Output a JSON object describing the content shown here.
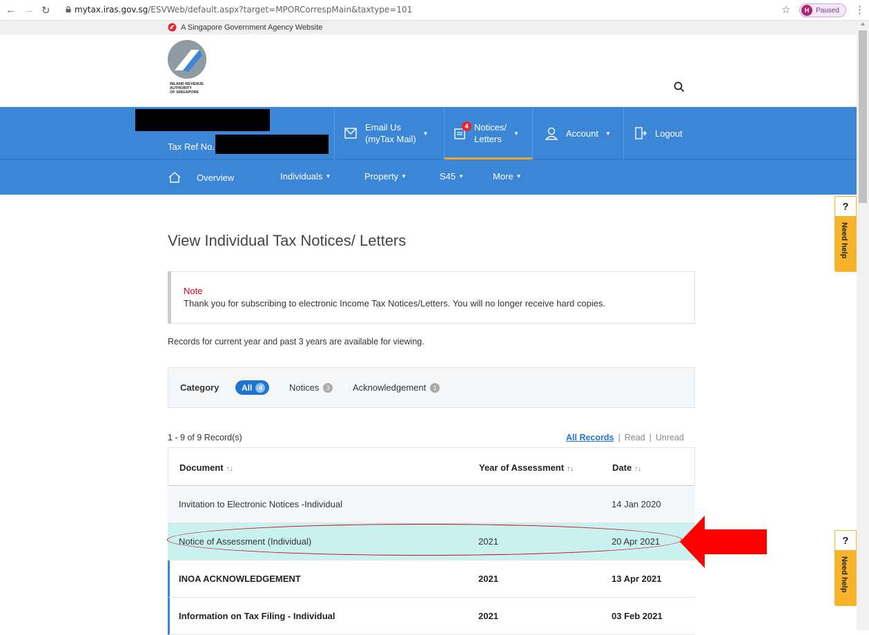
{
  "browser": {
    "url_host": "mytax.iras.gov.sg",
    "url_path": "/ESVWeb/default.aspx?target=MPORCorrespMain&taxtype=101",
    "profile_initial": "H",
    "profile_status": "Paused"
  },
  "gov_banner": "A Singapore Government Agency Website",
  "logo_text": [
    "INLAND REVENUE",
    "AUTHORITY",
    "OF SINGAPORE"
  ],
  "user": {
    "tax_ref_label": "Tax Ref No."
  },
  "topnav": {
    "email_line1": "Email Us",
    "email_line2": "(myTax Mail)",
    "notices_line1": "Notices/",
    "notices_line2": "Letters",
    "notices_badge": "4",
    "account": "Account",
    "logout": "Logout"
  },
  "subnav": {
    "overview": "Overview",
    "individuals": "Individuals",
    "property": "Property",
    "s45": "S45",
    "more": "More"
  },
  "need_help": {
    "q": "?",
    "label": "Need help"
  },
  "page": {
    "title": "View Individual Tax Notices/ Letters",
    "note_title": "Note",
    "note_body": "Thank you for subscribing to electronic Income Tax Notices/Letters. You will no longer receive hard copies.",
    "records_info": "Records for current year and past 3 years are available for viewing."
  },
  "category": {
    "label": "Category",
    "all": "All",
    "all_count": "4",
    "notices": "Notices",
    "notices_count": "3",
    "ack": "Acknowledgement",
    "ack_count": "1"
  },
  "records": {
    "count": "1 - 9 of 9 Record(s)",
    "filter_all": "All Records",
    "filter_read": "Read",
    "filter_unread": "Unread"
  },
  "table": {
    "headers": {
      "doc": "Document",
      "year": "Year of Assessment",
      "date": "Date"
    },
    "rows": [
      {
        "doc": "Invitation to Electronic Notices -Individual",
        "year": "",
        "date": "14 Jan 2020"
      },
      {
        "doc": "Notice of Assessment (Individual)",
        "year": "2021",
        "date": "20 Apr 2021"
      },
      {
        "doc": "INOA ACKNOWLEDGEMENT",
        "year": "2021",
        "date": "13 Apr 2021"
      },
      {
        "doc": "Information on Tax Filing - Individual",
        "year": "2021",
        "date": "03 Feb 2021"
      }
    ]
  },
  "colors": {
    "nav_blue": "#3b86d6",
    "highlight_row": "#c9f1f0",
    "annotation_red": "#ff0000",
    "help_tab": "#f7b32b"
  }
}
